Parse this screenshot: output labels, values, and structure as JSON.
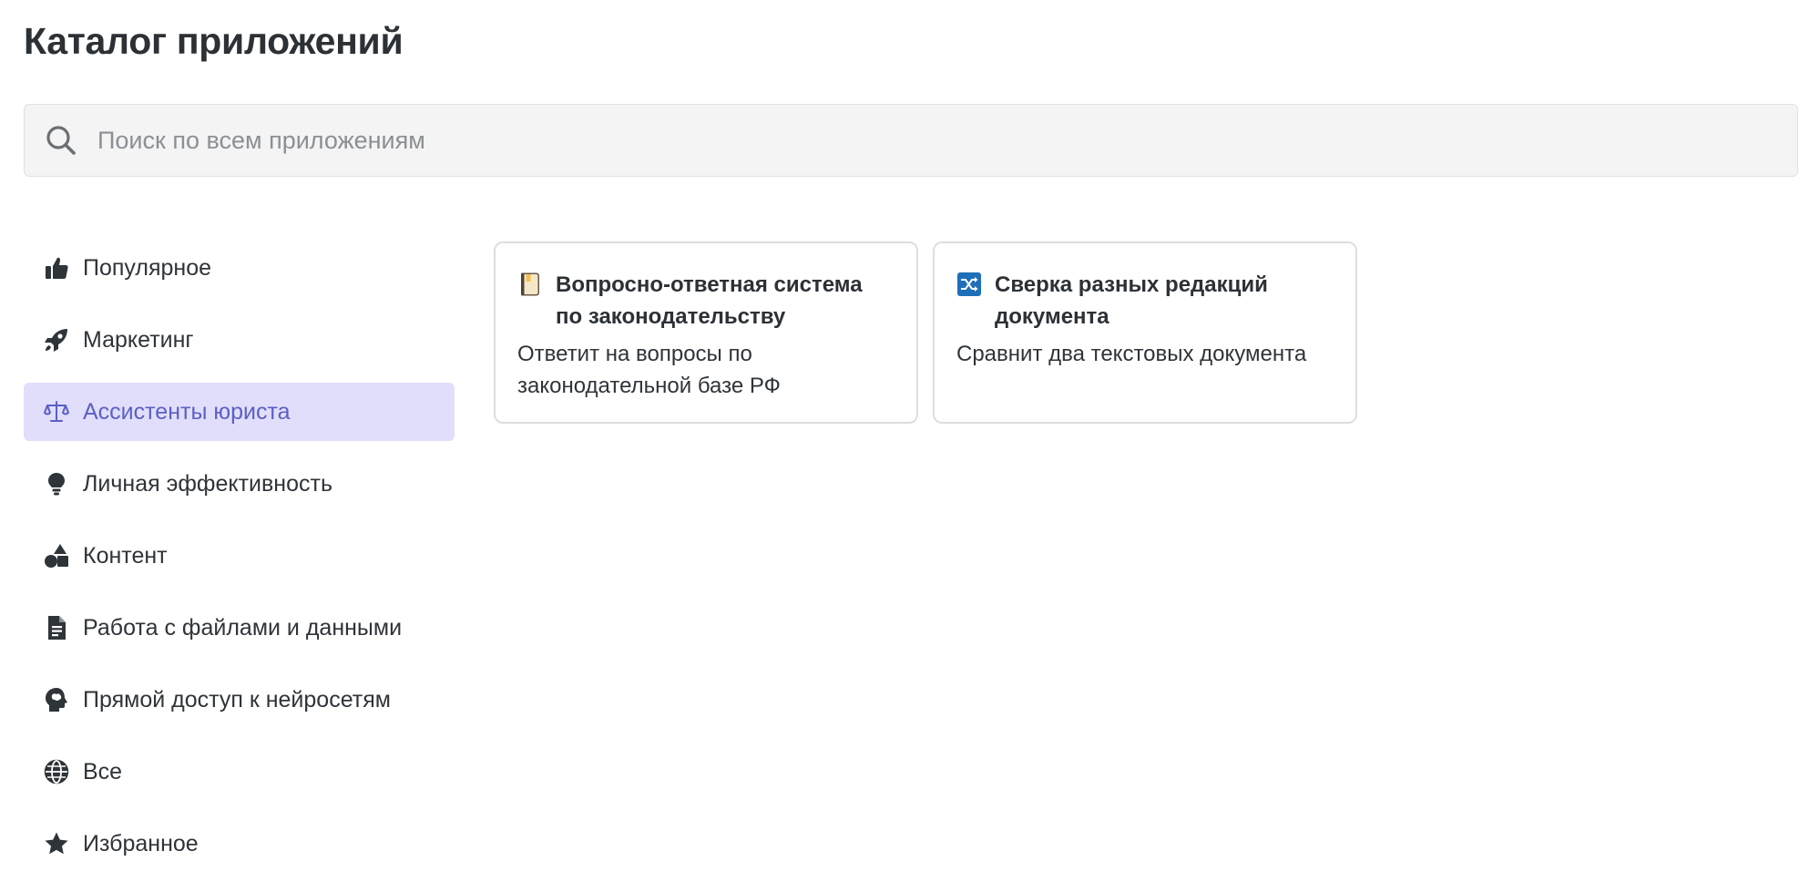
{
  "header": {
    "title": "Каталог приложений"
  },
  "search": {
    "placeholder": "Поиск по всем приложениям",
    "value": "",
    "icon": "search-icon"
  },
  "sidebar": {
    "active_index": 2,
    "items": [
      {
        "label": "Популярное",
        "icon": "thumbs-up-icon"
      },
      {
        "label": "Маркетинг",
        "icon": "rocket-icon"
      },
      {
        "label": "Ассистенты юриста",
        "icon": "scales-icon"
      },
      {
        "label": "Личная эффективность",
        "icon": "lightbulb-icon"
      },
      {
        "label": "Контент",
        "icon": "shapes-icon"
      },
      {
        "label": "Работа с файлами и данными",
        "icon": "file-lines-icon"
      },
      {
        "label": "Прямой доступ к нейросетям",
        "icon": "brain-head-icon"
      },
      {
        "label": "Все",
        "icon": "globe-icon"
      },
      {
        "label": "Избранное",
        "icon": "star-icon"
      }
    ]
  },
  "cards": [
    {
      "title": "Вопросно-ответная система по законодательству",
      "description": "Ответит на вопросы по законодательной базе РФ",
      "icon": "book-emoji-icon"
    },
    {
      "title": "Сверка разных редакций документа",
      "description": "Сравнит два текстовых документа",
      "icon": "shuffle-emoji-icon"
    }
  ],
  "colors": {
    "active_bg": "#e1defb",
    "active_text": "#5b5fc4",
    "text": "#2f3439",
    "search_bg": "#f3f4f3"
  }
}
